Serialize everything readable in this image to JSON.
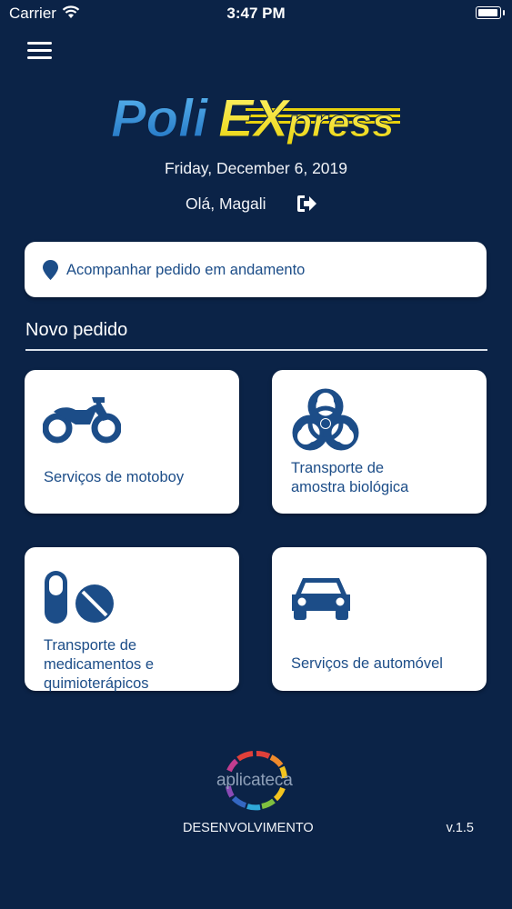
{
  "status_bar": {
    "carrier": "Carrier",
    "time": "3:47 PM"
  },
  "header": {
    "logo_text_poli": "Poli",
    "logo_text_ex": "EX",
    "logo_text_press": "press",
    "date": "Friday, December 6, 2019",
    "greeting": "Olá, Magali"
  },
  "track": {
    "label": "Acompanhar pedido em andamento"
  },
  "new_order": {
    "title": "Novo pedido",
    "cards": [
      {
        "label": "Serviços de motoboy",
        "icon": "motorcycle-icon"
      },
      {
        "label": "Transporte de\namostra biológica",
        "icon": "biohazard-icon"
      },
      {
        "label": "Transporte de\nmedicamentos e\nquimioterápicos",
        "icon": "pills-icon"
      },
      {
        "label": "Serviços de automóvel",
        "icon": "car-icon"
      }
    ]
  },
  "footer": {
    "brand": "aplicateca",
    "dev_label": "DESENVOLVIMENTO",
    "version": "v.1.5"
  },
  "colors": {
    "background": "#0b2347",
    "accent_blue": "#1c4d88",
    "logo_yellow": "#f4e61c",
    "logo_blue": "#2f8fd8"
  }
}
